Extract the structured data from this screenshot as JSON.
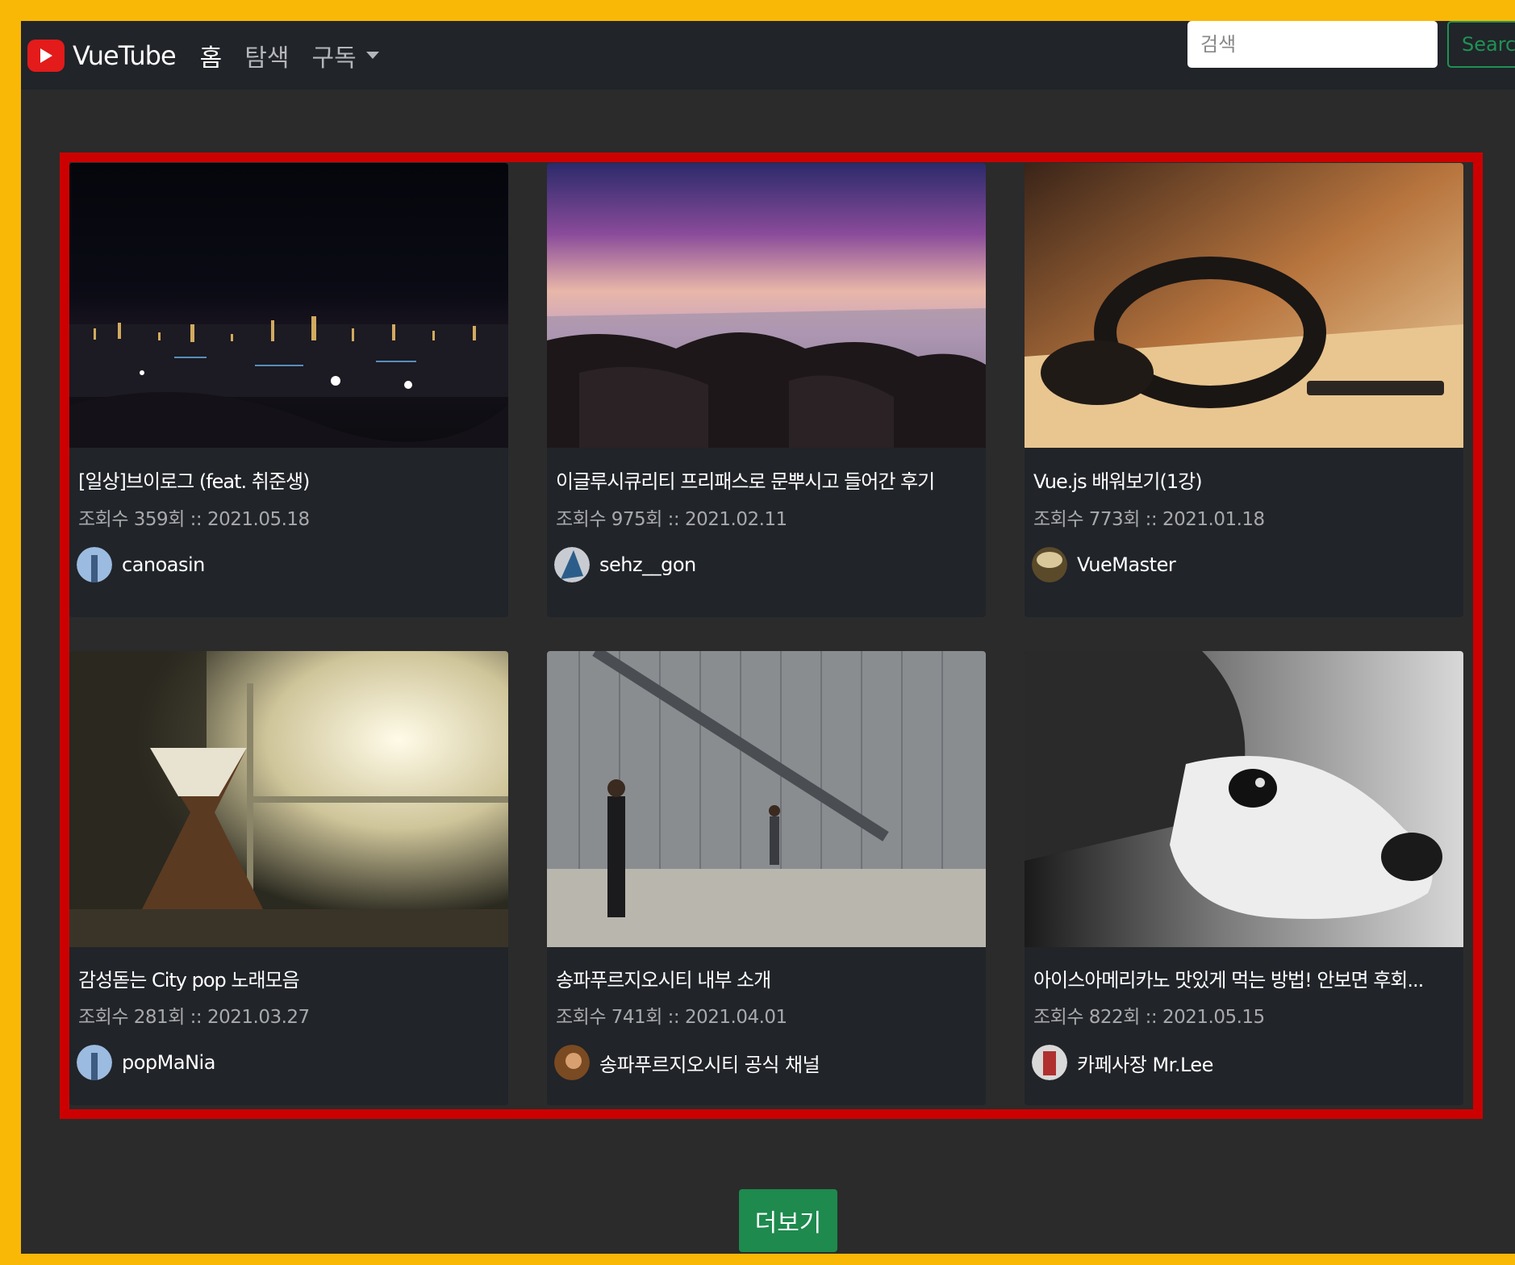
{
  "colors": {
    "outer_border": "#f9b806",
    "highlight_border": "#cc0000",
    "navbar_bg": "#212429",
    "page_bg": "#2b2b2b",
    "accent_green": "#1f9254",
    "logo_red": "#e31b1b"
  },
  "navbar": {
    "brand": "VueTube",
    "links": [
      "홈",
      "탐색",
      "구독"
    ],
    "search_placeholder": "검색",
    "search_button": "Search"
  },
  "videos": [
    {
      "title": "[일상]브이로그 (feat. 취준생)",
      "meta": "조회수 359회 :: 2021.05.18",
      "channel": "canoasin",
      "thumb_icon": "night-city-thumbnail"
    },
    {
      "title": "이글루시큐리티 프리패스로 문뿌시고 들어간 후기",
      "meta": "조회수 975회 :: 2021.02.11",
      "channel": "sehz__gon",
      "thumb_icon": "seashore-sunset-thumbnail"
    },
    {
      "title": "Vue.js 배워보기(1강)",
      "meta": "조회수 773회 :: 2021.01.18",
      "channel": "VueMaster",
      "thumb_icon": "headphones-thumbnail"
    },
    {
      "title": "감성돋는 City pop 노래모음",
      "meta": "조회수 281회 :: 2021.03.27",
      "channel": "popMaNia",
      "thumb_icon": "coffee-window-thumbnail"
    },
    {
      "title": "송파푸르지오시티 내부 소개",
      "meta": "조회수 741회 :: 2021.04.01",
      "channel": "송파푸르지오시티 공식 채널",
      "thumb_icon": "street-walkers-thumbnail"
    },
    {
      "title": "아이스아메리카노 맛있게 먹는 방법! 안보면 후회...",
      "meta": "조회수 822회 :: 2021.05.15",
      "channel": "카페사장 Mr.Lee",
      "thumb_icon": "dog-face-thumbnail"
    }
  ],
  "more_button": "더보기"
}
